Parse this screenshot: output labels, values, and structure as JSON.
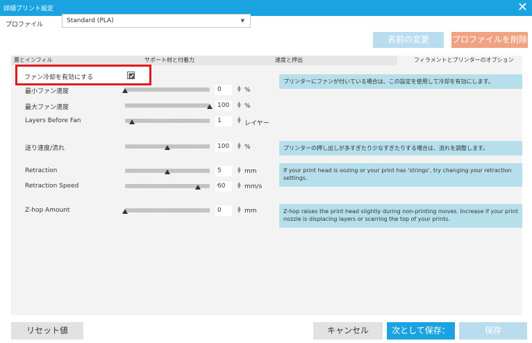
{
  "window": {
    "title": "詳細プリント設定"
  },
  "profile": {
    "label": "プロファイル",
    "value": "Standard (PLA)"
  },
  "buttons": {
    "rename": "名前の変更",
    "delete": "プロファイルを削除",
    "reset": "リセット値",
    "cancel": "キャンセル",
    "save_as": "次として保存：",
    "save": "保存"
  },
  "tabs": [
    "層とインフィル",
    "サポート材と付着力",
    "速度と押出",
    "フィラメントとプリンターのオプション"
  ],
  "fan_toggle": {
    "label": "ファン冷却を有効にする",
    "checked": true
  },
  "rows": [
    {
      "label": "最小ファン速度",
      "value": "0",
      "unit": "%",
      "level": 0
    },
    {
      "label": "最大ファン速度",
      "value": "100",
      "unit": "%",
      "level": 1.0
    },
    {
      "label": "Layers Before Fan",
      "value": "1",
      "unit": "レイヤー",
      "level": 0.08
    },
    {
      "label": "送り速度/流れ",
      "value": "100",
      "unit": "%",
      "level": 0.5
    },
    {
      "label": "Retraction",
      "value": "5",
      "unit": "mm",
      "level": 0.5
    },
    {
      "label": "Retraction Speed",
      "value": "60",
      "unit": "mm/s",
      "level": 0.85
    },
    {
      "label": "Z-hop Amount",
      "value": "0",
      "unit": "mm",
      "level": 0
    }
  ],
  "info": {
    "fan": "プリンターにファンが付いている場合は、この設定を使用して冷却を有効にします。",
    "flow": "プリンターの押し出しが多すぎたり少なすぎたりする場合は、流れを調整します。",
    "retraction": "If your print head is oozing or your print has 'strings', try changing your retraction settings.",
    "zhop": "Z-hop raises the print head slightly during non-printing moves. Increase if your print nozzle is displacing layers or scarring the top of your prints."
  },
  "colors": {
    "accent": "#1aa3e0",
    "delete": "#f0a282",
    "highlight": "#e0191e",
    "info_bg": "#b6dfeb"
  }
}
